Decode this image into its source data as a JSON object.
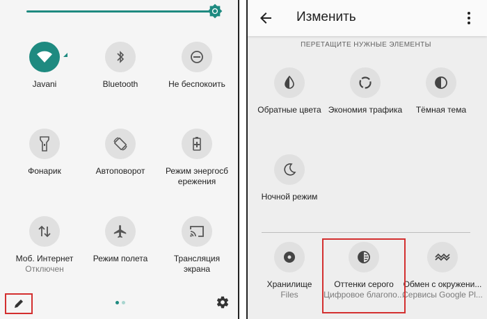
{
  "left": {
    "tiles": [
      {
        "label": "Javani",
        "sub": ""
      },
      {
        "label": "Bluetooth",
        "sub": ""
      },
      {
        "label": "Не беспокоить",
        "sub": ""
      },
      {
        "label": "Фонарик",
        "sub": ""
      },
      {
        "label": "Автоповорот",
        "sub": ""
      },
      {
        "label": "Режим энергосб",
        "label2": "ережения",
        "sub": ""
      },
      {
        "label": "Моб. Интернет",
        "sub": "Отключен"
      },
      {
        "label": "Режим полета",
        "sub": ""
      },
      {
        "label": "Трансляция",
        "label2": "экрана",
        "sub": ""
      }
    ],
    "accent": "#1e8a80"
  },
  "right": {
    "title": "Изменить",
    "hint": "ПЕРЕТАЩИТЕ НУЖНЫЕ ЭЛЕМЕНТЫ",
    "available": [
      {
        "label": "Обратные цвета"
      },
      {
        "label": "Экономия трафика"
      },
      {
        "label": "Тёмная тема"
      },
      {
        "label": "Ночной режим"
      }
    ],
    "active": [
      {
        "label": "Хранилище",
        "sub": "Files"
      },
      {
        "label": "Оттенки серого",
        "sub": "Цифровое благопо..."
      },
      {
        "label": "Обмен с окружени...",
        "sub": "Сервисы Google Pl..."
      }
    ]
  }
}
